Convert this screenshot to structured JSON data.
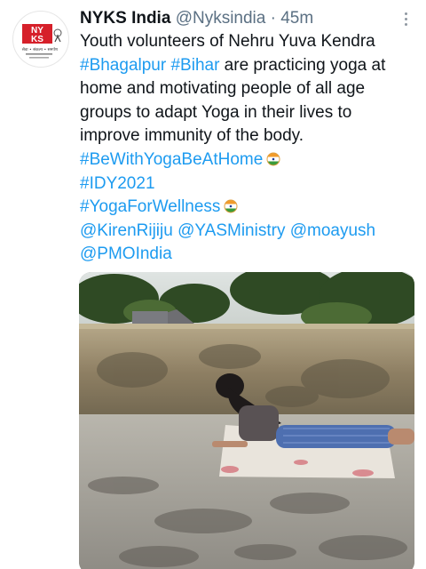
{
  "author": {
    "name": "NYKS India",
    "handle": "@Nyksindia",
    "separator": "·",
    "time": "45m",
    "avatar_logo_text": [
      "NY",
      "KS"
    ],
    "avatar_tagline": "सेवा • संकल्प • समर्पण"
  },
  "tweet": {
    "line1": "Youth volunteers of Nehru Yuva Kendra",
    "hashtag_bhagalpur": "#Bhagalpur",
    "hashtag_bihar": "#Bihar",
    "line2_rest": " are practicing yoga at",
    "line3": "home and motivating people of all age",
    "line4": "groups to adapt Yoga in their lives to",
    "line5": "improve immunity of the body.",
    "hashtag_bewithyoga": "#BeWithYogaBeAtHome",
    "hashtag_idy": "#IDY2021",
    "hashtag_wellness": "#YogaForWellness",
    "mention_kiren": "@KirenRijiju",
    "mention_yas": "@YASMinistry",
    "mention_moayush": "@moayush",
    "mention_pmo": "@PMOIndia"
  },
  "icons": {
    "more": "more-vertical-icon",
    "emoji": "india-flag-emoji-icon"
  },
  "colors": {
    "link": "#1d9bf0",
    "text": "#0f1419",
    "muted": "#5b7083",
    "logo_red": "#d6202a"
  }
}
